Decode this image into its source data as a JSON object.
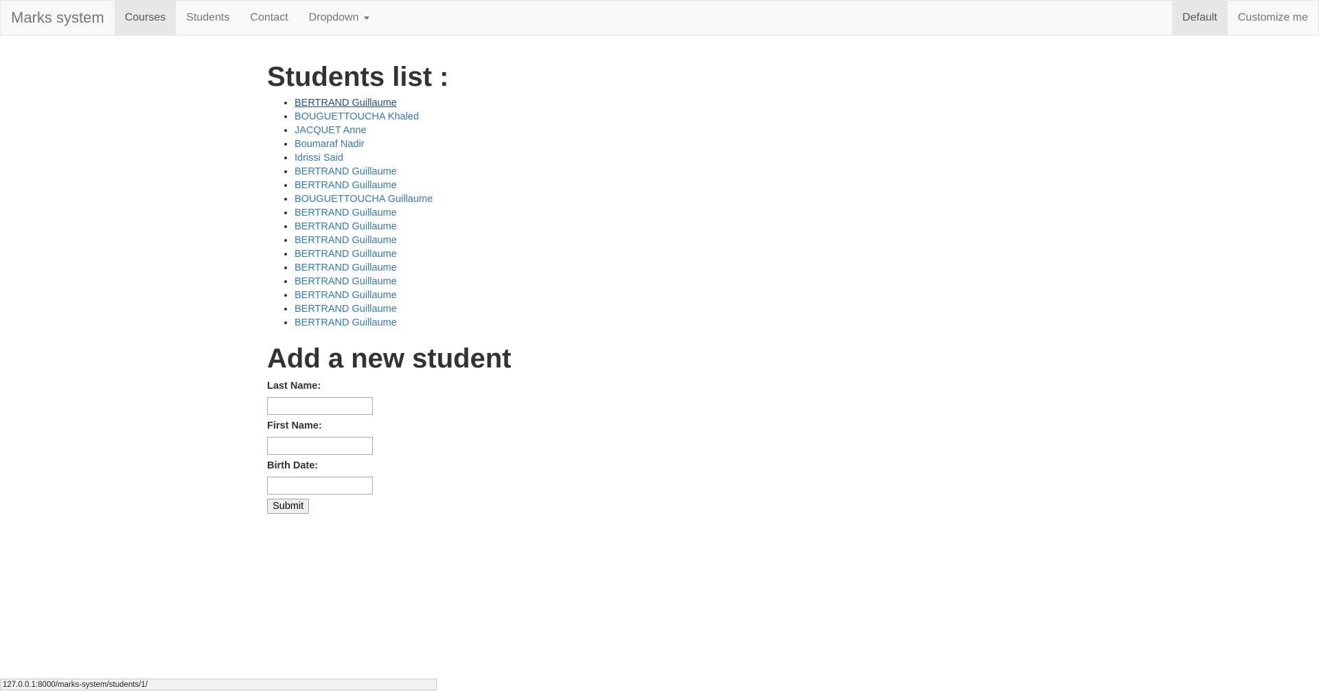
{
  "navbar": {
    "brand": "Marks system",
    "items": [
      {
        "label": "Courses",
        "active": true
      },
      {
        "label": "Students",
        "active": false
      },
      {
        "label": "Contact",
        "active": false
      },
      {
        "label": "Dropdown",
        "active": false
      }
    ],
    "right_items": [
      {
        "label": "Default",
        "active": true
      },
      {
        "label": "Customize me",
        "active": false
      }
    ]
  },
  "students": {
    "title": "Students list :",
    "items": [
      "BERTRAND Guillaume",
      "BOUGUETTOUCHA Khaled",
      "JACQUET Anne",
      "Boumaraf Nadir",
      "Idrissi Said",
      "BERTRAND Guillaume",
      "BERTRAND Guillaume",
      "BOUGUETTOUCHA Guillaume",
      "BERTRAND Guillaume",
      "BERTRAND Guillaume",
      "BERTRAND Guillaume",
      "BERTRAND Guillaume",
      "BERTRAND Guillaume",
      "BERTRAND Guillaume",
      "BERTRAND Guillaume",
      "BERTRAND Guillaume",
      "BERTRAND Guillaume"
    ]
  },
  "form": {
    "title": "Add a new student",
    "last_name_label": "Last Name:",
    "last_name_value": "",
    "first_name_label": "First Name:",
    "first_name_value": "",
    "birth_date_label": "Birth Date:",
    "birth_date_value": "",
    "submit_label": "Submit"
  },
  "status_bar": {
    "url": "127.0.0.1:8000/marks-system/students/1/"
  },
  "colors": {
    "link": "#337ab7",
    "link_hover": "#23527c",
    "navbar_bg": "#f8f8f8",
    "navbar_active": "#e7e7e7"
  }
}
